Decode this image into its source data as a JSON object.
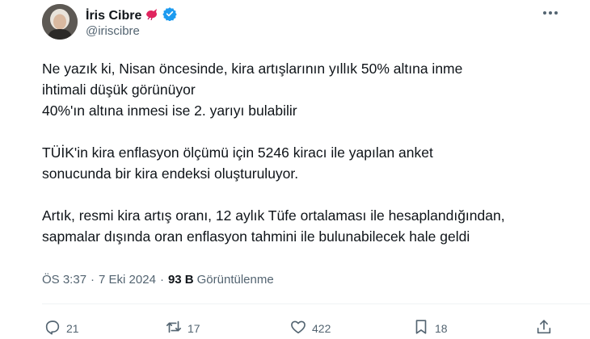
{
  "author": {
    "name": "İris Cibre",
    "handle": "@iriscibre",
    "verified": true,
    "badge_color": "#1d9bf0",
    "emoji_color": "#e0245e"
  },
  "tweet": {
    "lines": [
      "Ne yazık ki, Nisan öncesinde, kira artışlarının yıllık 50% altına inme",
      "ihtimali düşük görünüyor",
      "40%'ın altına inmesi ise 2. yarıyı bulabilir",
      "",
      "TÜİK'in kira enflasyon ölçümü için 5246 kiracı ile yapılan anket",
      "sonucunda bir kira endeksi oluşturuluyor.",
      "",
      "Artık, resmi kira artış oranı, 12 aylık Tüfe ortalaması ile hesaplandığından,",
      "sapmalar dışında oran enflasyon tahmini ile bulunabilecek hale geldi"
    ]
  },
  "meta": {
    "time": "ÖS 3:37",
    "separator": "·",
    "date": "7 Eki 2024",
    "views_count": "93 B",
    "views_label": "Görüntülenme"
  },
  "actions": {
    "replies": "21",
    "reposts": "17",
    "likes": "422",
    "bookmarks": "18"
  },
  "icons": [
    "more-icon",
    "verified-badge-icon",
    "bird-emoji-icon",
    "reply-icon",
    "repost-icon",
    "like-icon",
    "bookmark-icon",
    "share-icon"
  ]
}
